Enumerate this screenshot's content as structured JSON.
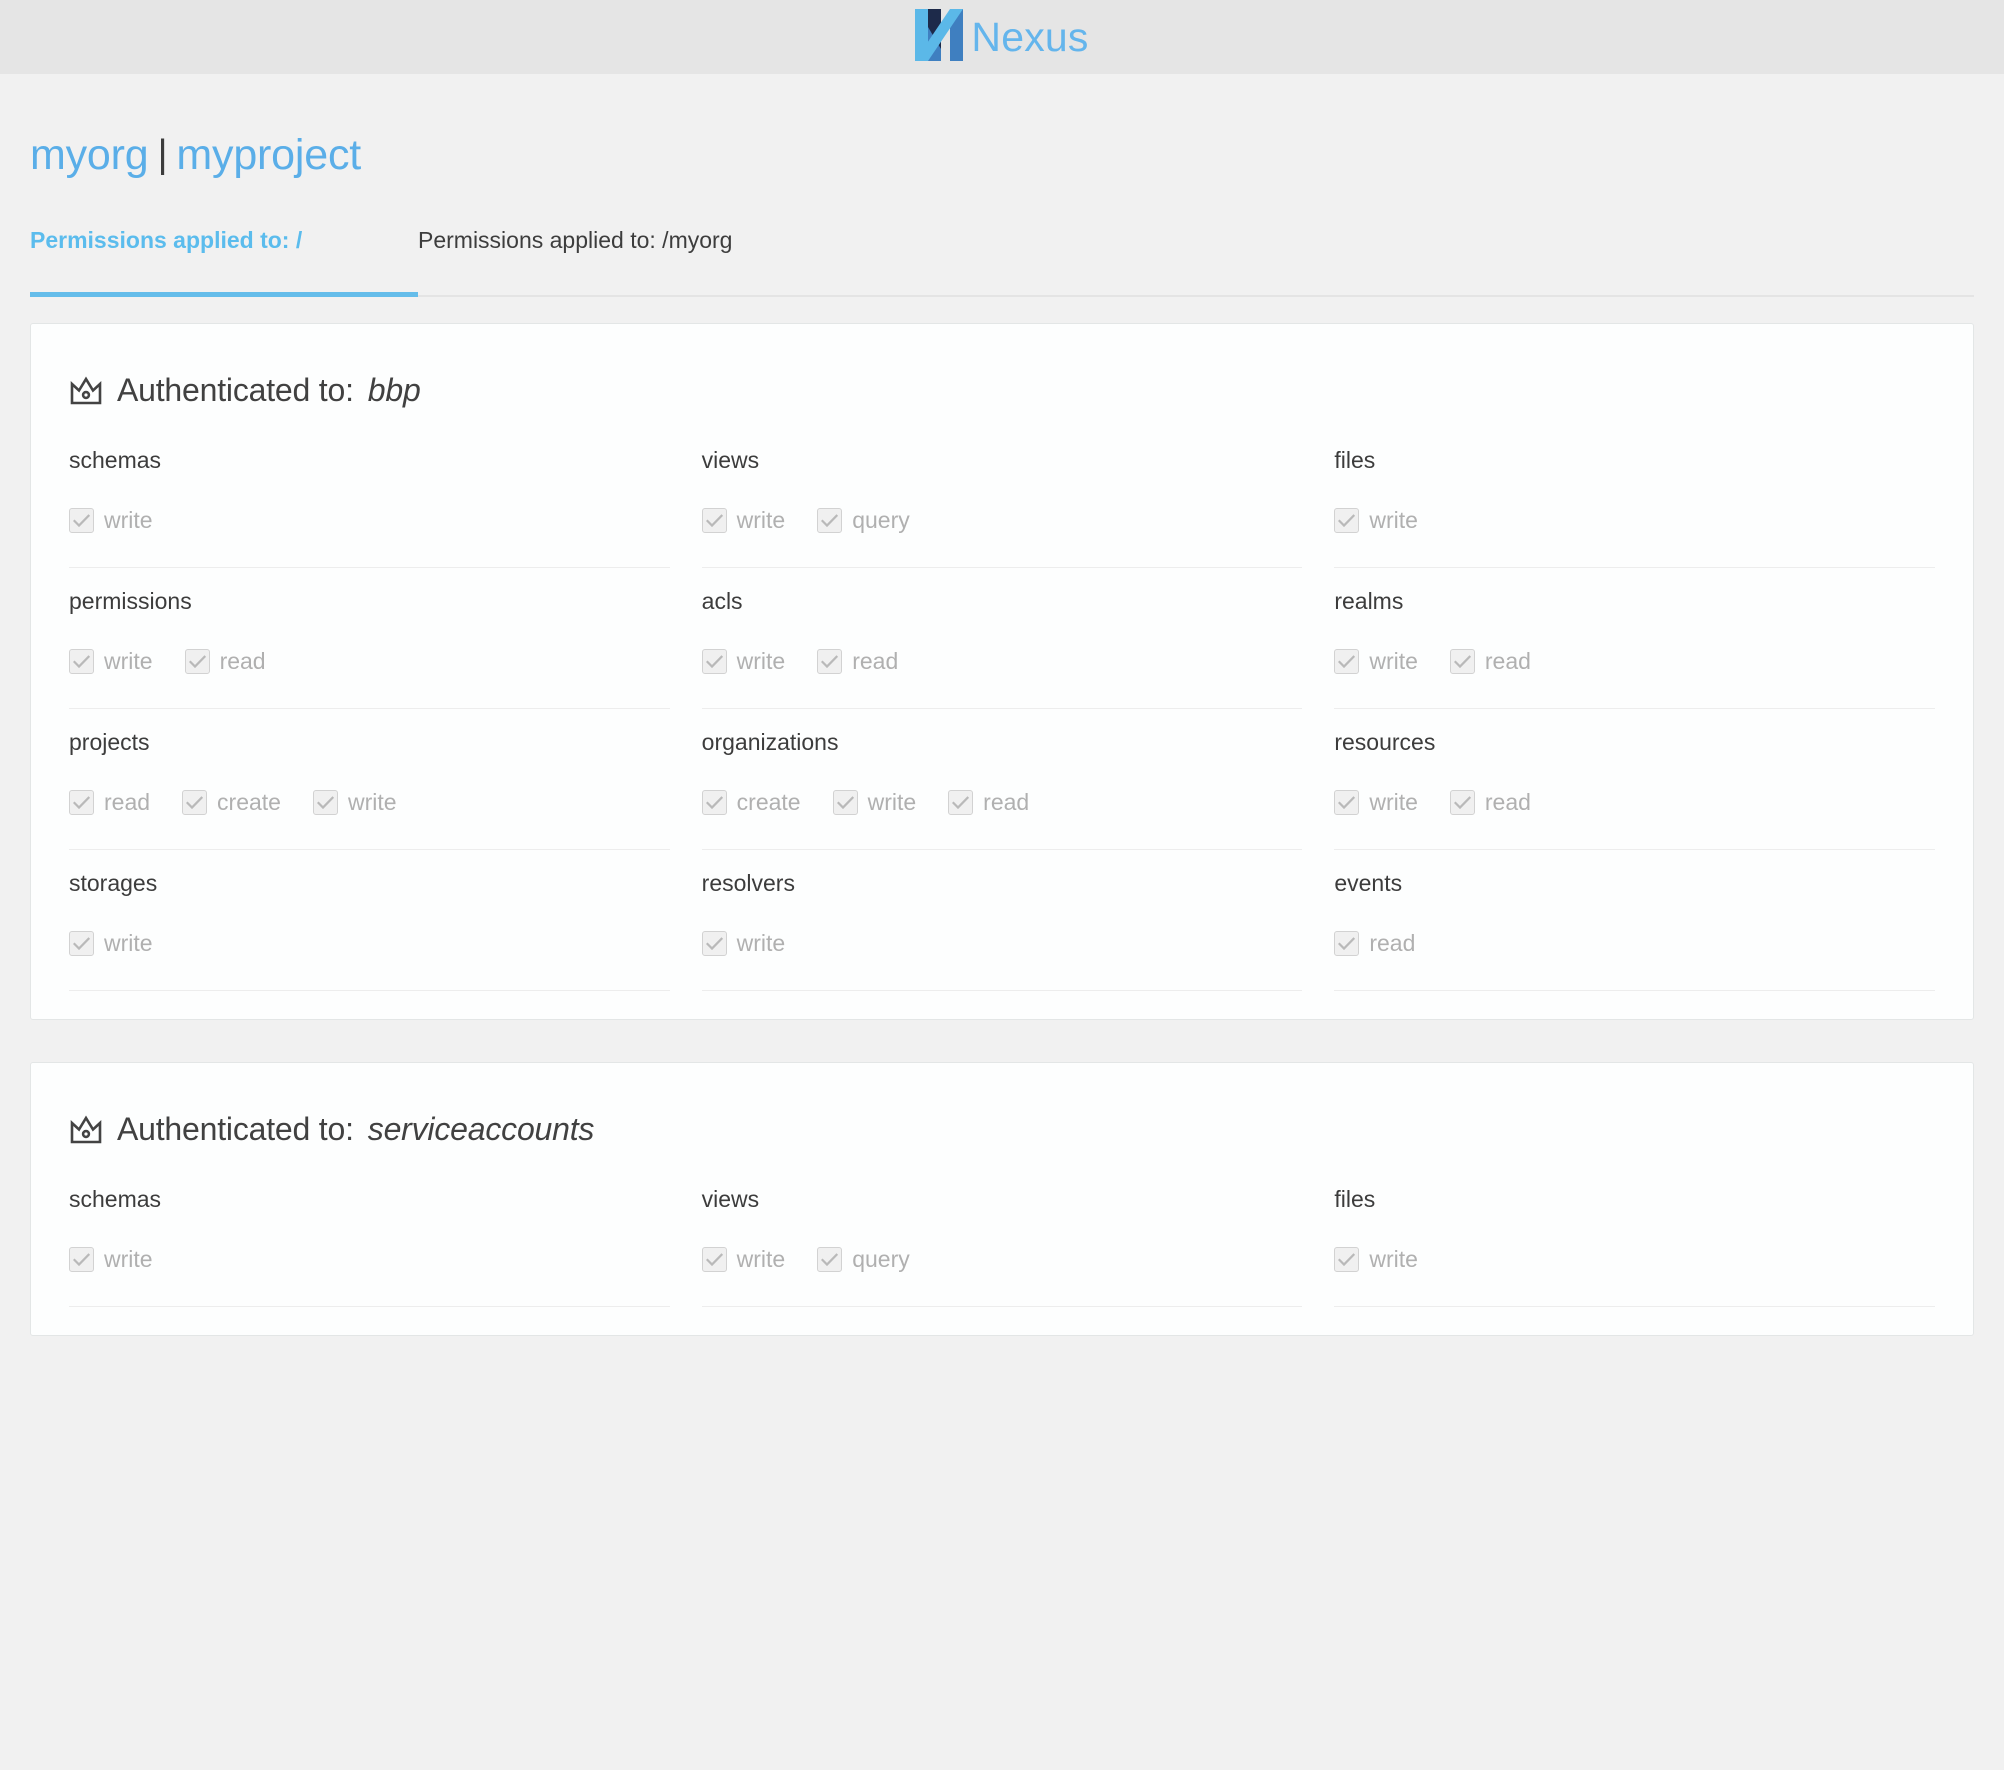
{
  "header": {
    "brand_name": "Nexus",
    "logo_icon": "nexus-n-logo",
    "logo_colors": {
      "light": "#5bb8e8",
      "mid": "#3f7fc0",
      "dark": "#1d2a4a"
    }
  },
  "breadcrumb": {
    "org": "myorg",
    "separator": "|",
    "project": "myproject"
  },
  "tabs": [
    {
      "label": "Permissions applied to: /",
      "active": true
    },
    {
      "label": "Permissions applied to: /myorg",
      "active": false
    }
  ],
  "colors": {
    "accent": "#65bdea",
    "link": "#5aaee8",
    "page_background": "#f1f1f1",
    "appbar_background": "#e5e5e5",
    "card_background": "#fdfefe",
    "card_border": "#e3e6e6",
    "divider": "#ededed",
    "checkbox_fill": "#f0f0f0",
    "checkbox_border": "#d2d2d2",
    "checkbox_check": "#b9b9b9",
    "disabled_label": "#b0b0b0",
    "text": "#3c3c3c"
  },
  "cards": [
    {
      "icon": "crown-icon",
      "title_prefix": "Authenticated to:",
      "identity": "bbp",
      "permissions": [
        {
          "name": "schemas",
          "actions": [
            {
              "label": "write",
              "checked": true
            }
          ]
        },
        {
          "name": "views",
          "actions": [
            {
              "label": "write",
              "checked": true
            },
            {
              "label": "query",
              "checked": true
            }
          ]
        },
        {
          "name": "files",
          "actions": [
            {
              "label": "write",
              "checked": true
            }
          ]
        },
        {
          "name": "permissions",
          "actions": [
            {
              "label": "write",
              "checked": true
            },
            {
              "label": "read",
              "checked": true
            }
          ]
        },
        {
          "name": "acls",
          "actions": [
            {
              "label": "write",
              "checked": true
            },
            {
              "label": "read",
              "checked": true
            }
          ]
        },
        {
          "name": "realms",
          "actions": [
            {
              "label": "write",
              "checked": true
            },
            {
              "label": "read",
              "checked": true
            }
          ]
        },
        {
          "name": "projects",
          "actions": [
            {
              "label": "read",
              "checked": true
            },
            {
              "label": "create",
              "checked": true
            },
            {
              "label": "write",
              "checked": true
            }
          ]
        },
        {
          "name": "organizations",
          "actions": [
            {
              "label": "create",
              "checked": true
            },
            {
              "label": "write",
              "checked": true
            },
            {
              "label": "read",
              "checked": true
            }
          ]
        },
        {
          "name": "resources",
          "actions": [
            {
              "label": "write",
              "checked": true
            },
            {
              "label": "read",
              "checked": true
            }
          ]
        },
        {
          "name": "storages",
          "actions": [
            {
              "label": "write",
              "checked": true
            }
          ]
        },
        {
          "name": "resolvers",
          "actions": [
            {
              "label": "write",
              "checked": true
            }
          ]
        },
        {
          "name": "events",
          "actions": [
            {
              "label": "read",
              "checked": true
            }
          ]
        }
      ]
    },
    {
      "icon": "crown-icon",
      "title_prefix": "Authenticated to:",
      "identity": "serviceaccounts",
      "permissions": [
        {
          "name": "schemas",
          "actions": [
            {
              "label": "write",
              "checked": true
            }
          ]
        },
        {
          "name": "views",
          "actions": [
            {
              "label": "write",
              "checked": true
            },
            {
              "label": "query",
              "checked": true
            }
          ]
        },
        {
          "name": "files",
          "actions": [
            {
              "label": "write",
              "checked": true
            }
          ]
        }
      ]
    }
  ]
}
